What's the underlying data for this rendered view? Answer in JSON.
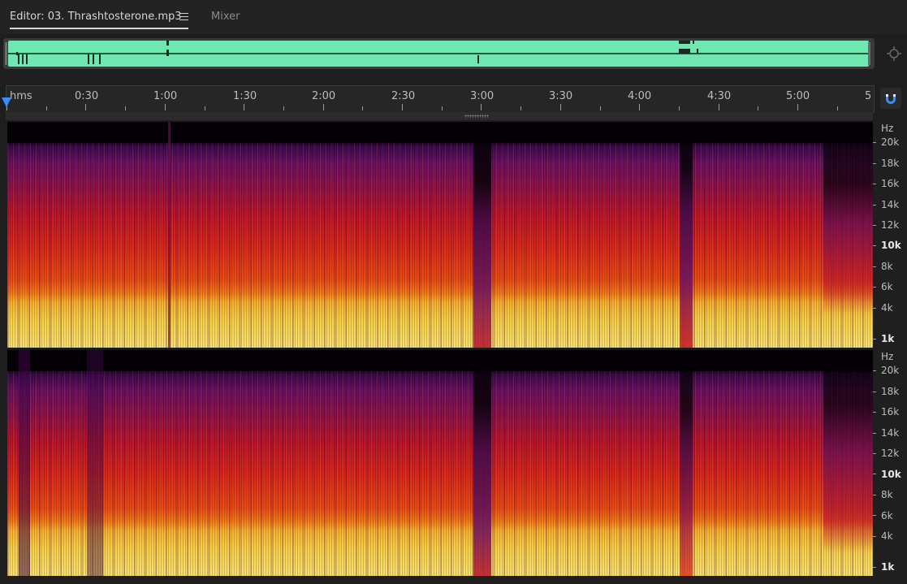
{
  "tabs": {
    "editor_label": "Editor: 03. Thrashtosterone.mp3",
    "mixer_label": "Mixer"
  },
  "ruler": {
    "labels": [
      "hms",
      "0:30",
      "1:00",
      "1:30",
      "2:00",
      "2:30",
      "3:00",
      "3:30",
      "4:00",
      "4:30",
      "5:00",
      "5"
    ]
  },
  "freq_axis": {
    "unit": "Hz",
    "labels": [
      "20k",
      "18k",
      "16k",
      "14k",
      "12k",
      "10k",
      "8k",
      "6k",
      "4k",
      "1k"
    ]
  },
  "colors": {
    "overview_waveform": "#6ee7b0",
    "playhead": "#3b8cf5",
    "background": "#1e1e1e"
  },
  "icons": {
    "menu": "hamburger-menu-icon",
    "zoom": "zoom-navigator-icon",
    "snap": "magnet-snap-icon"
  }
}
